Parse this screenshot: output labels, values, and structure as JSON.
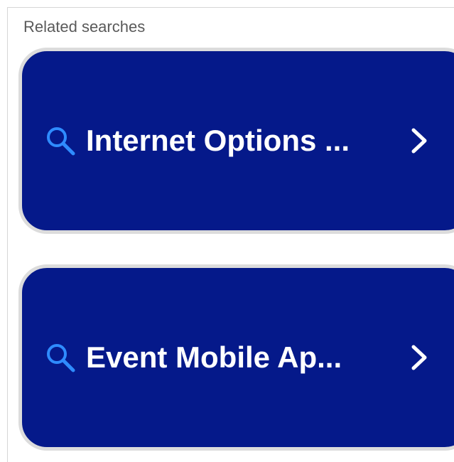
{
  "section": {
    "heading": "Related searches"
  },
  "suggestions": [
    {
      "label": "Internet Options ...",
      "icon": "search-icon",
      "action_icon": "chevron-right-icon"
    },
    {
      "label": "Event Mobile Ap...",
      "icon": "search-icon",
      "action_icon": "chevron-right-icon"
    }
  ],
  "colors": {
    "card_background": "#05198a",
    "card_border": "#dcdcdc",
    "icon_accent": "#2f8cff",
    "label_text": "#ffffff",
    "heading_text": "#5a5a5a"
  }
}
